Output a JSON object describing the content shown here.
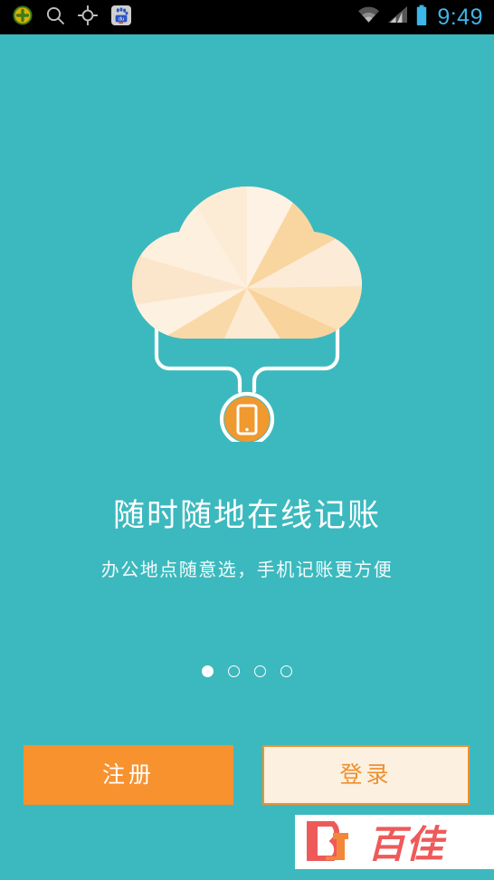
{
  "status_bar": {
    "icons_left": [
      "plus-circle-icon",
      "search-icon",
      "gps-crosshair-icon",
      "baidu-app-icon"
    ],
    "baidu_label": "du",
    "icons_right": [
      "wifi-icon",
      "signal-bars-icon",
      "battery-icon"
    ],
    "time": "9:49",
    "time_color": "#3DB6E8",
    "background": "#000000"
  },
  "illustration": {
    "name": "cloud-to-phone-illustration",
    "cloud_icon": "low-poly-cloud-icon",
    "device_icon": "smartphone-icon",
    "connector": "cloud-link-lines",
    "cloud_colors": [
      "#FDEFDC",
      "#FBE5C4",
      "#FAD9A8",
      "#F9D29B",
      "#FCEAD0"
    ],
    "accent": "#F0992E"
  },
  "content": {
    "headline": "随时随地在线记账",
    "subhead": "办公地点随意选，手机记账更方便"
  },
  "pager": {
    "total": 4,
    "active_index": 0,
    "dots": [
      "page-dot-1",
      "page-dot-2",
      "page-dot-3",
      "page-dot-4"
    ]
  },
  "actions": {
    "register_label": "注册",
    "login_label": "登录",
    "register_bg": "#F7922F",
    "login_bg": "#FCF0E0",
    "login_text_color": "#F0902C"
  },
  "watermark": {
    "monogram_b": "B",
    "monogram_j": "J",
    "brand": "百佳",
    "red": "#EE5A5A",
    "orange": "#F2873A"
  },
  "theme": {
    "background": "#3CB9BE",
    "text_on_bg": "#FFFFFF"
  }
}
